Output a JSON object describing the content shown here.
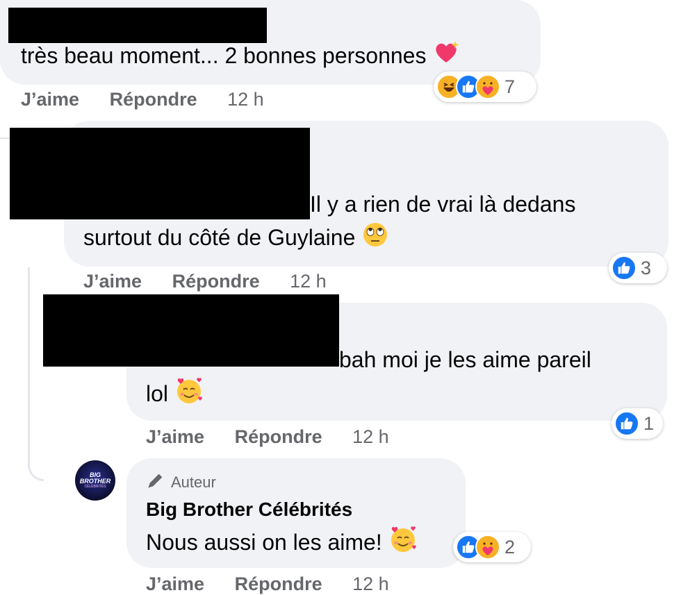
{
  "comments": [
    {
      "text": "très beau moment... 2 bonnes personnes",
      "like_label": "J’aime",
      "reply_label": "Répondre",
      "time": "12 h",
      "reaction_count": "7"
    },
    {
      "text_line1": "Il y a rien de vrai là dedans",
      "text_line2": "surtout du côté de Guylaine",
      "like_label": "J’aime",
      "reply_label": "Répondre",
      "time": "12 h",
      "reaction_count": "3"
    },
    {
      "text_line1": "bah moi je les aime pareil",
      "text_line2": "lol",
      "like_label": "J’aime",
      "reply_label": "Répondre",
      "time": "12 h",
      "reaction_count": "1"
    },
    {
      "author_badge": "Auteur",
      "author_name": "Big Brother Célébrités",
      "text": "Nous aussi on les aime!",
      "like_label": "J’aime",
      "reply_label": "Répondre",
      "time": "12 h",
      "reaction_count": "2"
    }
  ],
  "avatar": {
    "label_line1": "BIG",
    "label_line2": "BROTHER",
    "label_line3": "CÉLÉBRITÉS"
  },
  "colors": {
    "bubble": "#f0f2f5",
    "like_blue": "#1877f2",
    "muted": "#65676b"
  },
  "icons": [
    "sparkling-heart-icon",
    "laughing-icon",
    "like-icon",
    "care-icon",
    "eye-roll-icon",
    "smiling-hearts-icon",
    "pencil-icon"
  ]
}
